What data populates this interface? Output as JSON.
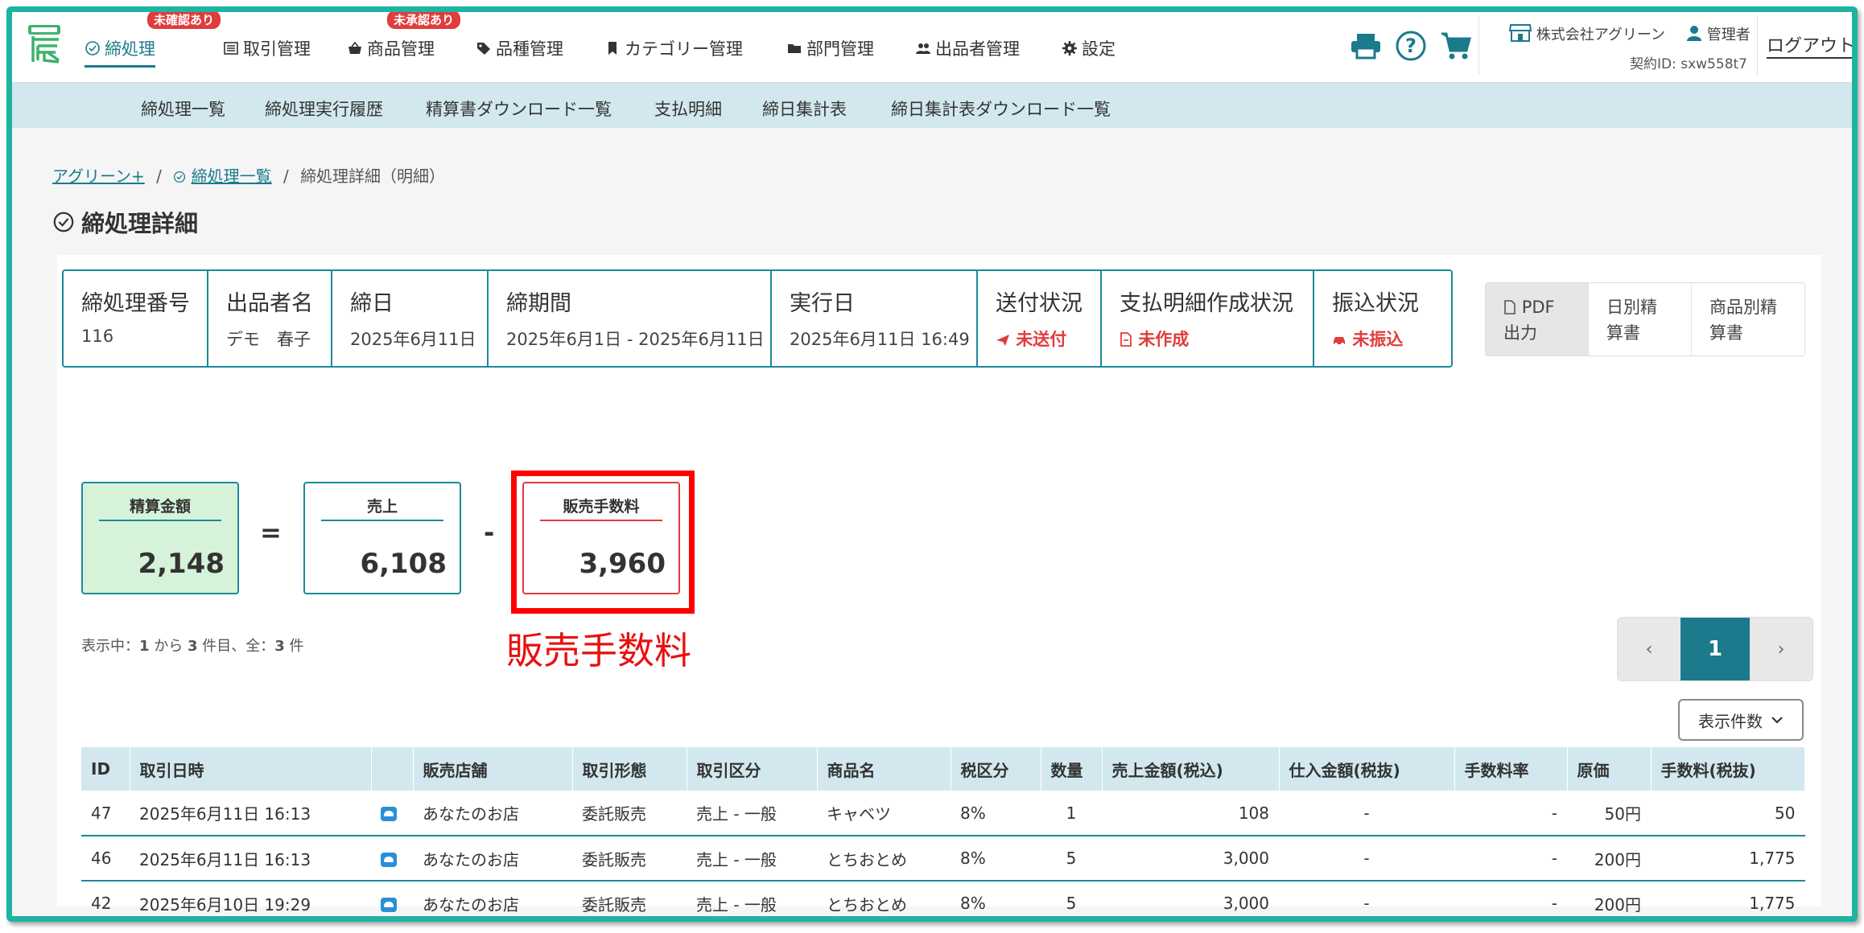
{
  "colors": {
    "accent": "#1b7a8c",
    "border": "#1b8a9c",
    "alert": "#e03c3c",
    "highlight": "#ff0000",
    "frame": "#1fb3a1"
  },
  "nav": {
    "items": [
      {
        "label": "締処理",
        "icon": "check-circle-icon",
        "badge": "未確認あり"
      },
      {
        "label": "取引管理",
        "icon": "ledger-icon",
        "badge": ""
      },
      {
        "label": "商品管理",
        "icon": "basket-icon",
        "badge": "未承認あり"
      },
      {
        "label": "品種管理",
        "icon": "tag-icon",
        "badge": ""
      },
      {
        "label": "カテゴリー管理",
        "icon": "bookmark-icon",
        "badge": ""
      },
      {
        "label": "部門管理",
        "icon": "folder-icon",
        "badge": ""
      },
      {
        "label": "出品者管理",
        "icon": "users-icon",
        "badge": ""
      },
      {
        "label": "設定",
        "icon": "gear-icon",
        "badge": ""
      }
    ],
    "company": "株式会社アグリーン",
    "user": "管理者",
    "contract": "契約ID: sxw558t7",
    "logout": "ログアウト"
  },
  "subnav": [
    "締処理一覧",
    "締処理実行履歴",
    "精算書ダウンロード一覧",
    "支払明細",
    "締日集計表",
    "締日集計表ダウンロード一覧"
  ],
  "breadcrumb": {
    "home": "アグリーン+",
    "list": "締処理一覧",
    "current": "締処理詳細（明細）",
    "sep": "/"
  },
  "page_title": "締処理詳細",
  "info": {
    "number": {
      "label": "締処理番号",
      "value": "116"
    },
    "seller": {
      "label": "出品者名",
      "value": "デモ　春子"
    },
    "close_date": {
      "label": "締日",
      "value": "2025年6月11日"
    },
    "period": {
      "label": "締期間",
      "value": "2025年6月1日 - 2025年6月11日"
    },
    "exec_date": {
      "label": "実行日",
      "value": "2025年6月11日 16:49"
    },
    "send_status": {
      "label": "送付状況",
      "value": "未送付"
    },
    "statement_status": {
      "label": "支払明細作成状況",
      "value": "未作成"
    },
    "transfer_status": {
      "label": "振込状況",
      "value": "未振込"
    }
  },
  "buttons": {
    "pdf_1": "PDF",
    "pdf_2": "出力",
    "daily_1": "日別精",
    "daily_2": "算書",
    "product_1": "商品別精",
    "product_2": "算書"
  },
  "formula": {
    "settlement": {
      "label": "精算金額",
      "value": "2,148"
    },
    "eq": "=",
    "sales": {
      "label": "売上",
      "value": "6,108"
    },
    "minus": "-",
    "fee": {
      "label": "販売手数料",
      "value": "3,960"
    }
  },
  "annotation": "販売手数料",
  "count_text": {
    "pre": "表示中：",
    "from": "1",
    "mid1": " から ",
    "to": "3",
    "mid2": " 件目、全：",
    "total": "3",
    "post": " 件"
  },
  "pager": {
    "prev": "‹",
    "current": "1",
    "next": "›"
  },
  "per_page": "表示件数",
  "table": {
    "headers": [
      "ID",
      "取引日時",
      "",
      "販売店舗",
      "取引形態",
      "取引区分",
      "商品名",
      "税区分",
      "数量",
      "売上金額(税込)",
      "仕入金額(税抜)",
      "手数料率",
      "原価",
      "手数料(税抜)"
    ],
    "rows": [
      [
        "47",
        "2025年6月11日 16:13",
        "あなたのお店",
        "委託販売",
        "売上 - 一般",
        "キャベツ",
        "8%",
        "1",
        "108",
        "-",
        "-",
        "50円",
        "50"
      ],
      [
        "46",
        "2025年6月11日 16:13",
        "あなたのお店",
        "委託販売",
        "売上 - 一般",
        "とちおとめ",
        "8%",
        "5",
        "3,000",
        "-",
        "-",
        "200円",
        "1,775"
      ],
      [
        "42",
        "2025年6月10日 19:29",
        "あなたのお店",
        "委託販売",
        "売上 - 一般",
        "とちおとめ",
        "8%",
        "5",
        "3,000",
        "-",
        "-",
        "200円",
        "1,775"
      ]
    ]
  }
}
